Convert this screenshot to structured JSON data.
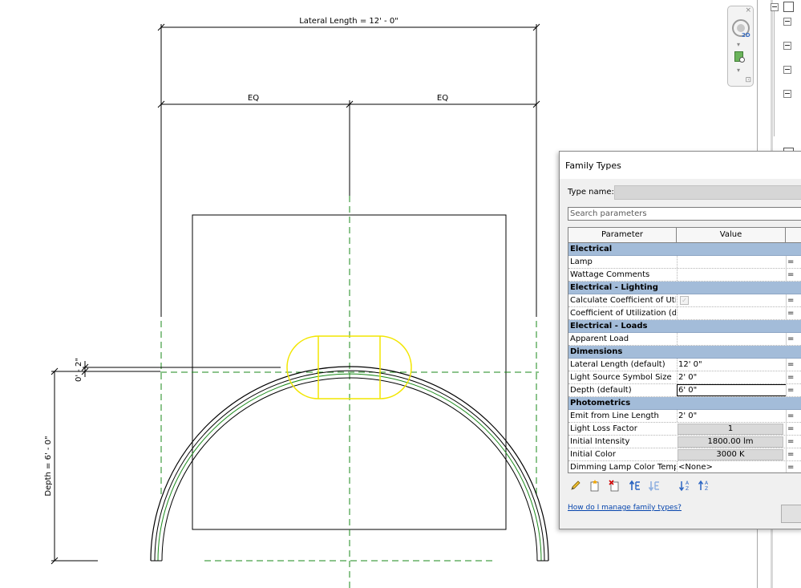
{
  "drawing": {
    "dim_lateral": "Lateral Length = 12' - 0\"",
    "dim_eq_left": "EQ",
    "dim_eq_right": "EQ",
    "dim_offset": "0' - 2\"",
    "dim_depth": "Depth = 6' - 0\"",
    "colors": {
      "line": "#000000",
      "ref_plane": "#008000",
      "selection": "#ffff00"
    }
  },
  "navigation_bar": {
    "label_2d": "2D",
    "icons": [
      "close-icon",
      "steering-wheel-icon",
      "zoom-icon",
      "dropdown-icon",
      "customize-icon"
    ]
  },
  "dialog": {
    "title": "Family Types",
    "type_name_label": "Type name:",
    "type_name_value": "",
    "search_placeholder": "Search parameters",
    "columns": {
      "parameter": "Parameter",
      "value": "Value"
    },
    "groups": [
      {
        "name": "Electrical",
        "params": [
          {
            "name": "Lamp",
            "value": "",
            "formula": "="
          },
          {
            "name": "Wattage Comments",
            "value": "",
            "formula": "="
          }
        ]
      },
      {
        "name": "Electrical - Lighting",
        "params": [
          {
            "name": "Calculate Coefficient of Utiliz",
            "value": "✓",
            "formula": "="
          },
          {
            "name": "Coefficient of Utilization (def",
            "value": "",
            "formula": "="
          }
        ]
      },
      {
        "name": "Electrical - Loads",
        "params": [
          {
            "name": "Apparent Load",
            "value": "",
            "formula": "="
          }
        ]
      },
      {
        "name": "Dimensions",
        "params": [
          {
            "name": "Lateral Length (default)",
            "value": "12'  0\"",
            "formula": "="
          },
          {
            "name": "Light Source Symbol Size",
            "value": "2'  0\"",
            "formula": "="
          },
          {
            "name": "Depth (default)",
            "value": "6'  0\"",
            "formula": "="
          }
        ]
      },
      {
        "name": "Photometrics",
        "params": [
          {
            "name": "Emit from Line Length",
            "value": "2'  0\"",
            "formula": "="
          },
          {
            "name": "Light Loss Factor",
            "value": "1",
            "formula": "="
          },
          {
            "name": "Initial Intensity",
            "value": "1800.00 lm",
            "formula": "="
          },
          {
            "name": "Initial Color",
            "value": "3000 K",
            "formula": "="
          },
          {
            "name": "Dimming Lamp Color Tempe",
            "value": "<None>",
            "formula": "="
          }
        ]
      }
    ],
    "toolbar_icons": [
      "pencil-icon",
      "new-type-icon",
      "delete-type-icon",
      "move-up-icon",
      "move-down-icon",
      "sort-ascending-icon",
      "sort-descending-icon"
    ],
    "help_link": "How do I manage family types?",
    "colors": {
      "group_header": "#a3bcd9",
      "link": "#0645ad"
    }
  }
}
